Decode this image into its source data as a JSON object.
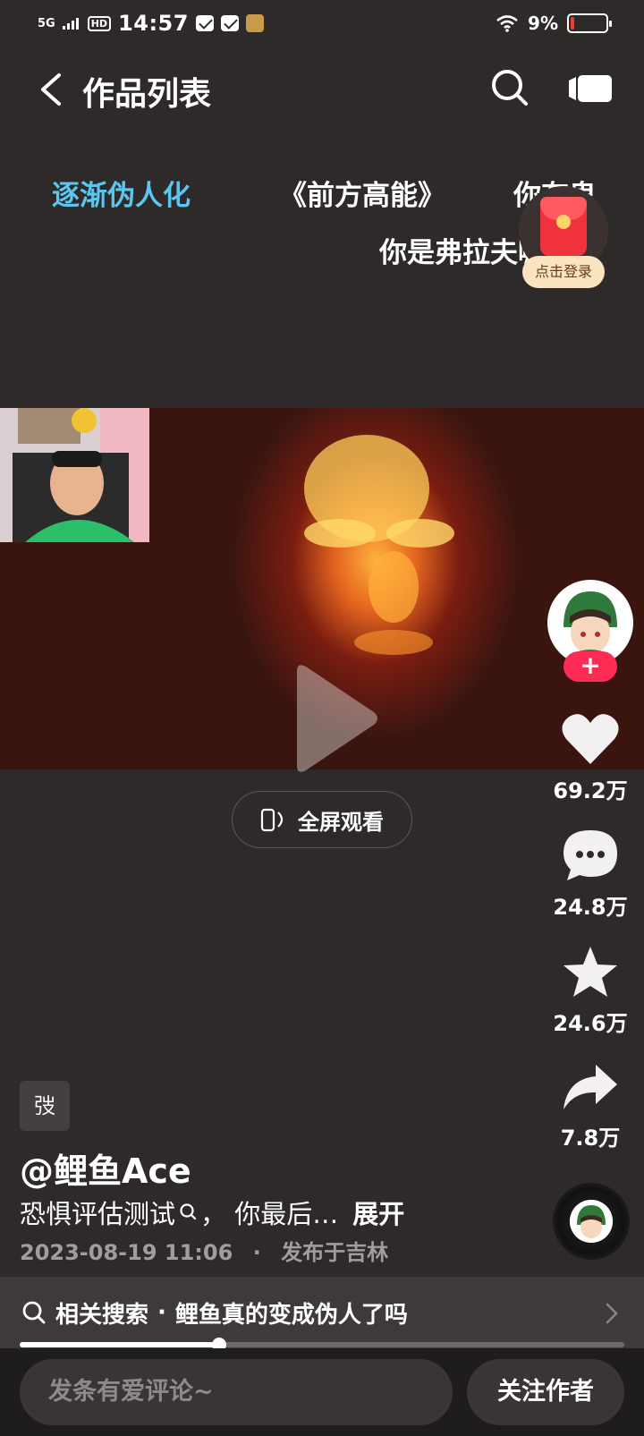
{
  "status_bar": {
    "network": "5G",
    "hd": "HD",
    "time": "14:57",
    "battery_percent": "9%",
    "battery_level": 0.09
  },
  "header": {
    "title": "作品列表",
    "back_icon": "chevron-left-icon",
    "search_icon": "search-icon",
    "camera_icon": "video-camera-icon"
  },
  "danmaku": [
    "逐渐伪人化",
    "《前方高能》",
    "你有鬼",
    "你是弗拉夫嘛"
  ],
  "red_packet": {
    "label": "点击登录"
  },
  "video": {
    "fullscreen_label": "全屏观看"
  },
  "actions": {
    "like_count": "69.2万",
    "comment_count": "24.8万",
    "favorite_count": "24.6万",
    "share_count": "7.8万",
    "follow_plus": "+"
  },
  "post": {
    "tag": "弢",
    "author": "@鲤鱼Ace",
    "description": "恐惧评估测试",
    "description_rest": "， 你最后…",
    "expand_label": "展开",
    "date": "2023-08-19 11:06",
    "separator": "·",
    "location": "发布于吉林"
  },
  "related_search": {
    "label": "相关搜索",
    "dot": "·",
    "query": "鲤鱼真的变成伪人了吗"
  },
  "progress": {
    "fraction": 0.33
  },
  "bottom": {
    "comment_placeholder": "发条有爱评论~",
    "follow_author_label": "关注作者"
  },
  "colors": {
    "background": "#2f2a2a",
    "accent_red": "#fe2c55",
    "danmaku_blue": "#5bc6f0"
  }
}
